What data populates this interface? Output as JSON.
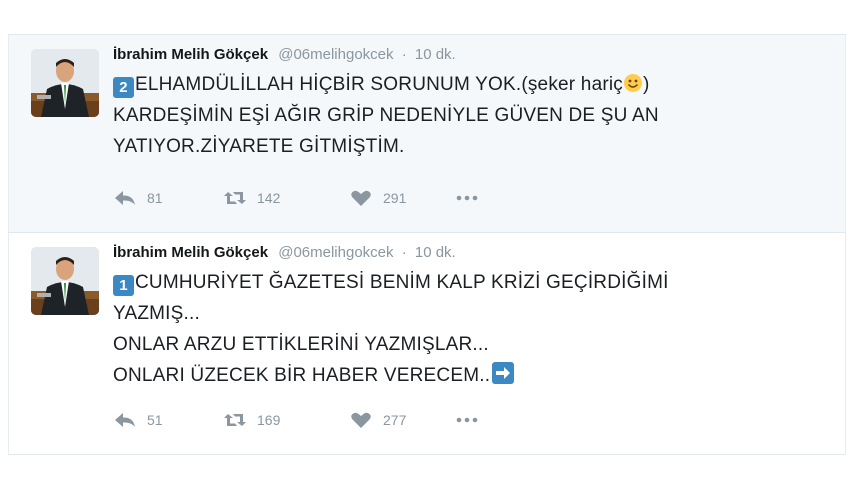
{
  "tweets": [
    {
      "fullname": "İbrahim Melih Gökçek",
      "handle": "@06melihgokcek",
      "separator": "·",
      "time": "10 dk.",
      "keycap": "2",
      "text_line1": "ELHAMDÜLİLLAH HİÇBİR SORUNUM YOK.(şeker hariç",
      "text_line1_end": ")",
      "text_line2": "KARDEŞİMİN EŞİ AĞIR GRİP NEDENİYLE GÜVEN DE ŞU AN",
      "text_line3": "YATIYOR.ZİYARETE GİTMİŞTİM.",
      "emoji": "smiling-face-emoji",
      "replies": "81",
      "retweets": "142",
      "likes": "291"
    },
    {
      "fullname": "İbrahim Melih Gökçek",
      "handle": "@06melihgokcek",
      "separator": "·",
      "time": "10 dk.",
      "keycap": "1",
      "text_line1": "CUMHURİYET ĞAZETESİ  BENİM KALP KRİZİ GEÇİRDİĞİMİ",
      "text_line2": "YAZMIŞ...",
      "text_line3": "ONLAR ARZU ETTİKLERİNİ YAZMIŞLAR...",
      "text_line4": "ONLARI ÜZECEK BİR HABER VERECEM..",
      "emoji": "right-arrow-emoji",
      "replies": "51",
      "retweets": "169",
      "likes": "277"
    }
  ],
  "colors": {
    "accent_blue": "#3b88c3",
    "muted_gray": "#8a96a0",
    "text_dark": "#1b1f23",
    "highlight_bg": "#f5f8fa"
  },
  "icons": [
    "reply-icon",
    "retweet-icon",
    "like-icon",
    "more-icon"
  ]
}
